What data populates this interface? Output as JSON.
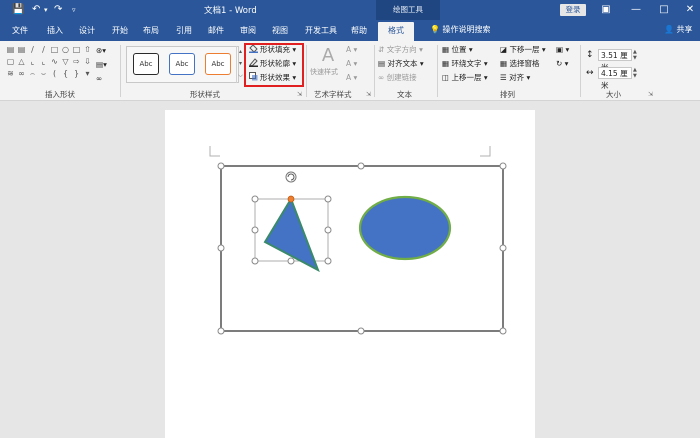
{
  "titlebar": {
    "doc_title": "文档1 - Word",
    "drawing_tools": "绘图工具",
    "login": "登录",
    "qa_save_icon": "save-icon",
    "qa_undo_icon": "undo-icon",
    "qa_redo_icon": "redo-icon"
  },
  "tabs": {
    "items": [
      "文件",
      "插入",
      "设计",
      "开始",
      "布局",
      "引用",
      "邮件",
      "审阅",
      "视图",
      "开发工具",
      "帮助"
    ],
    "active": "格式",
    "tell_me": "操作说明搜索",
    "share": "共享"
  },
  "ribbon": {
    "insert_shapes_label": "插入形状",
    "shape_styles_label": "形状样式",
    "style_sample": "Abc",
    "shape_fill": "形状填充",
    "shape_outline": "形状轮廓",
    "shape_effects": "形状效果",
    "quick_styles": "快速样式",
    "wordart_label": "艺术字样式",
    "text_direction": "文字方向",
    "align_text": "对齐文本",
    "create_link": "创建链接",
    "text_label": "文本",
    "position": "位置",
    "wrap_text": "环绕文字",
    "bring_forward": "上移一层",
    "send_backward": "下移一层",
    "selection_pane": "选择窗格",
    "align": "对齐",
    "arrange_label": "排列",
    "height_value": "3.51 厘米",
    "width_value": "4.15 厘米",
    "size_label": "大小"
  },
  "colors": {
    "title_blue": "#2b579a",
    "shape_fill": "#4472c4",
    "ellipse_outline": "#70ad47",
    "triangle_outline": "#3a8a6a",
    "highlight_red": "#e02020",
    "rotate_handle": "#ed7d31"
  }
}
